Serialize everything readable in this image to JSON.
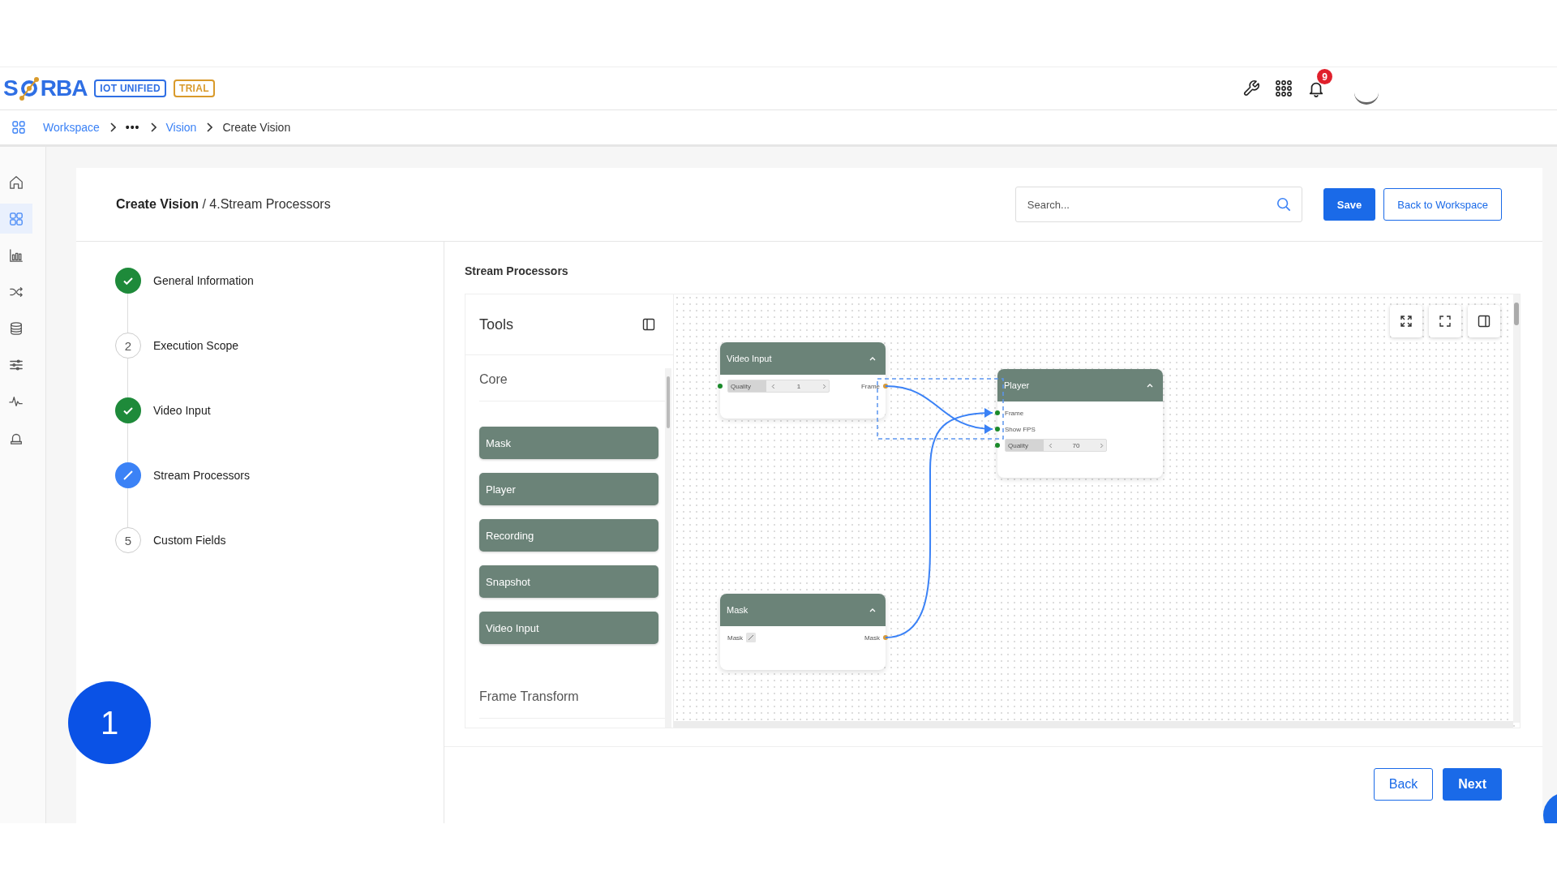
{
  "header": {
    "logo": [
      "S",
      "RBA"
    ],
    "badges": [
      {
        "label": "IOT UNIFIED",
        "color": "#2f6fe4"
      },
      {
        "label": "TRIAL",
        "color": "#d99a2b"
      }
    ],
    "notification_count": "9"
  },
  "breadcrumb": [
    {
      "label": "Workspace",
      "kind": "link"
    },
    {
      "label": "•••",
      "kind": "ellipsis"
    },
    {
      "label": "Vision",
      "kind": "link"
    },
    {
      "label": "Create Vision",
      "kind": "current"
    }
  ],
  "sidebar": {
    "items": [
      {
        "selected": false
      },
      {
        "selected": true
      },
      {
        "selected": false
      },
      {
        "selected": false
      },
      {
        "selected": false
      },
      {
        "selected": false
      },
      {
        "selected": false
      },
      {
        "selected": false
      }
    ]
  },
  "page": {
    "title": "**Create Vision** / 4.Stream Processors",
    "search": {
      "placeholder": "Search..."
    },
    "buttons": [
      {
        "label": "Save",
        "kind": "primary"
      },
      {
        "label": "Back to Workspace",
        "kind": "outline"
      }
    ]
  },
  "steps": [
    {
      "label": "General Information",
      "completed": true,
      "active": false
    },
    {
      "number": "2",
      "label": "Execution Scope",
      "completed": false,
      "active": false
    },
    {
      "label": "Video Input",
      "completed": true,
      "active": false
    },
    {
      "label": "Stream Processors",
      "completed": false,
      "active": true
    },
    {
      "number": "5",
      "label": "Custom Fields",
      "completed": false,
      "active": false
    }
  ],
  "section_title": "Stream Processors",
  "tools": {
    "title": "Tools",
    "groups": [
      {
        "title": "Core",
        "items": [
          "Mask",
          "Player",
          "Recording",
          "Snapshot",
          "Video Input"
        ]
      },
      {
        "title": "Frame Transform"
      }
    ]
  },
  "nodes": [
    {
      "title": "Video Input",
      "rows": [
        {
          "kind": "field",
          "label": "Quality",
          "value": "1",
          "output": "Frame"
        }
      ]
    },
    {
      "title": "Player",
      "rows": [
        {
          "kind": "input",
          "label": "Frame"
        },
        {
          "kind": "input",
          "label": "Show FPS"
        },
        {
          "kind": "field",
          "label": "Quality",
          "value": "70"
        }
      ]
    },
    {
      "title": "Mask",
      "rows": [
        {
          "kind": "edit",
          "label": "Mask",
          "output": "Mask"
        }
      ]
    }
  ],
  "footer_buttons": [
    {
      "label": "Back",
      "kind": "outline"
    },
    {
      "label": "Next",
      "kind": "primary"
    }
  ],
  "tour_marker": "1"
}
